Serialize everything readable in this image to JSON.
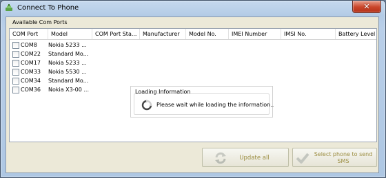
{
  "window": {
    "title": "Connect To Phone",
    "close_label": "✕"
  },
  "group": {
    "caption": "Available Com Ports"
  },
  "table": {
    "columns": [
      "COM Port",
      "Model",
      "COM Port Sta...",
      "Manufacturer",
      "Model No.",
      "IMEI Number",
      "IMSI No.",
      "Battery Level"
    ],
    "rows": [
      {
        "port": "COM8",
        "model": "Nokia 5233 ..."
      },
      {
        "port": "COM22",
        "model": "Standard Mo..."
      },
      {
        "port": "COM17",
        "model": "Nokia 5233 ..."
      },
      {
        "port": "COM33",
        "model": "Nokia 5530 ..."
      },
      {
        "port": "COM34",
        "model": "Standard Mo..."
      },
      {
        "port": "COM36",
        "model": "Nokia X3-00 ..."
      }
    ]
  },
  "loading": {
    "caption": "Loading Information",
    "message": "Please wait while loading the information.."
  },
  "buttons": {
    "update_all": "Update all",
    "select_phone": "Select phone to send SMS"
  },
  "colors": {
    "title_bar": "#b3cbe6",
    "close_button": "#c9452a",
    "button_text": "#9c8e42"
  }
}
